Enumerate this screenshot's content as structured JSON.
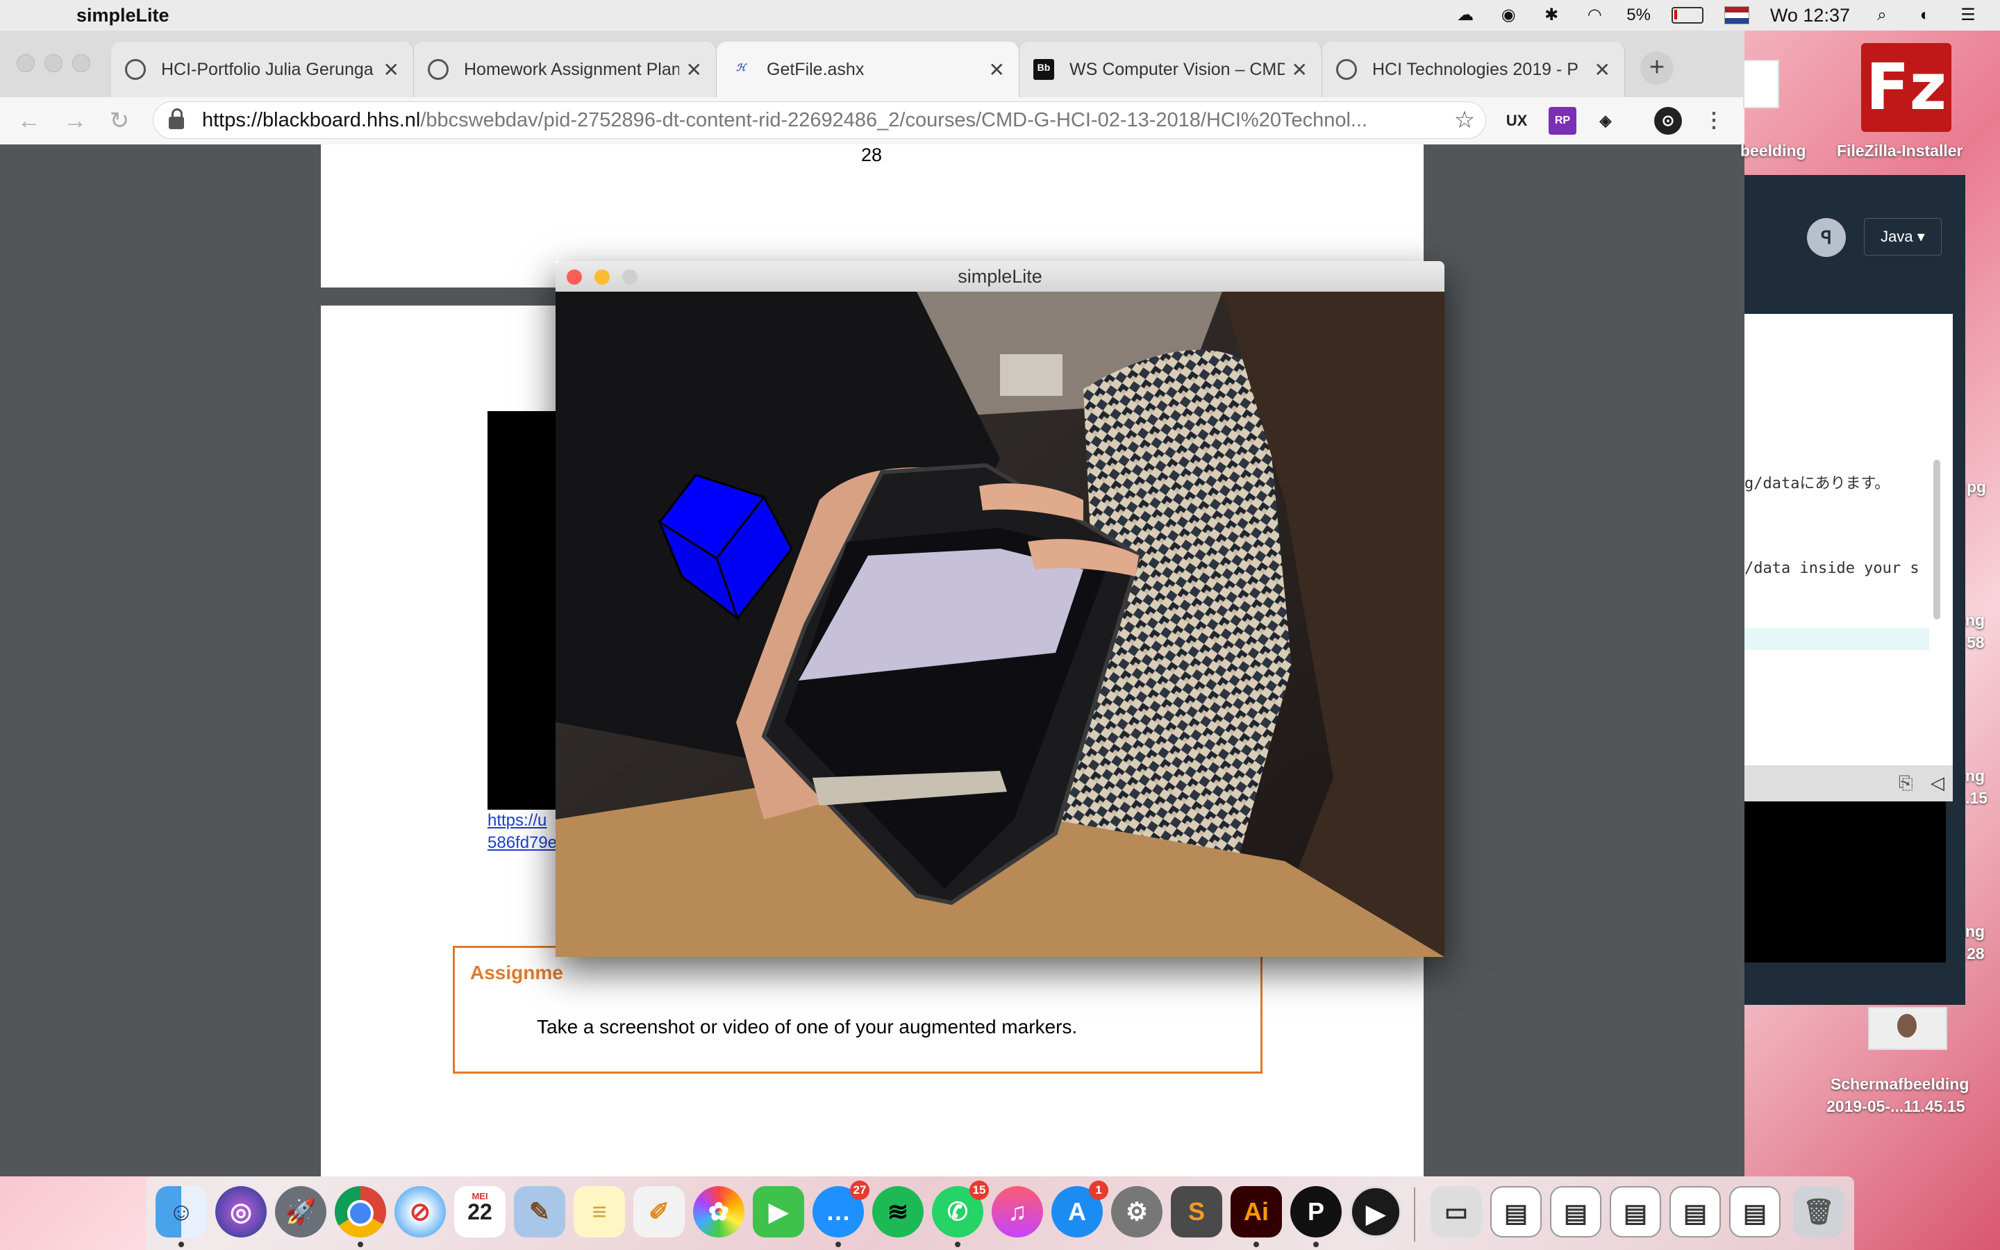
{
  "menubar": {
    "app_name": "simpleLite",
    "battery": "5%",
    "clock": "Wo 12:37"
  },
  "browser": {
    "tabs": [
      {
        "title": "HCI-Portfolio Julia Gerunga",
        "icon": "globe-icon"
      },
      {
        "title": "Homework Assignment Plan",
        "icon": "globe-icon"
      },
      {
        "title": "GetFile.ashx",
        "icon": "file-icon"
      },
      {
        "title": "WS Computer Vision – CMD",
        "icon": "blackboard-icon"
      },
      {
        "title": "HCI Technologies 2019 - P",
        "icon": "globe-icon"
      }
    ],
    "url_host": "https://blackboard.hhs.nl",
    "url_path": "/bbcswebdav/pid-2752896-dt-content-rid-22692486_2/courses/CMD-G-HCI-02-13-2018/HCI%20Technol...",
    "extensions": [
      "UX",
      "RP",
      "◈",
      "⊙"
    ]
  },
  "pdf": {
    "page_number": "28",
    "link_line1": "https://u",
    "link_line2": "586fd79e",
    "assignment_label": "Assignme",
    "assignment_text": "Take a screenshot or video of one of your augmented markers."
  },
  "simplelite": {
    "title": "simpleLite",
    "cube_color": "#0000ff"
  },
  "side_window": {
    "language": "Java",
    "code_line1": "g/dataにあります。",
    "code_line2": "/data inside your s"
  },
  "desktop": {
    "filezilla_label": "FileZilla-Installer",
    "screenshot_label1": "Schermafbeelding",
    "screenshot_label2": "2019-05-...11.45.15",
    "partial_label_top": "beelding",
    "edge_labels": [
      "pg",
      "ng",
      "58",
      "ng",
      ".15",
      "ng",
      "28"
    ]
  },
  "dock": {
    "calendar_month": "MEI",
    "calendar_day": "22",
    "messages_badge": "27",
    "whatsapp_badge": "15",
    "appstore_badge": "1",
    "illustrator_label": "Ai"
  }
}
